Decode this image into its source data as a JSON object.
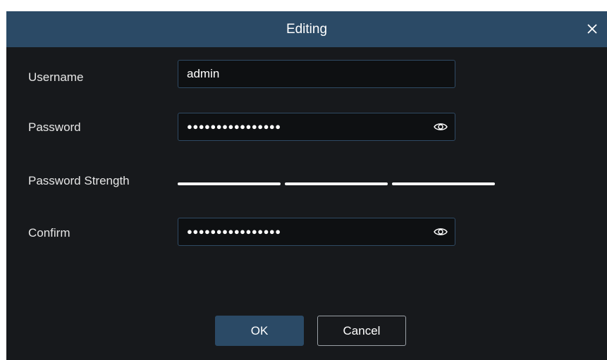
{
  "dialog": {
    "title": "Editing",
    "close_icon": "close-icon"
  },
  "form": {
    "username": {
      "label": "Username",
      "value": "admin"
    },
    "password": {
      "label": "Password",
      "value_masked": "●●●●●●●●●●●●●●●●",
      "reveal_icon": "eye-icon"
    },
    "strength": {
      "label": "Password Strength",
      "segments": 3,
      "filled": 3
    },
    "confirm": {
      "label": "Confirm",
      "value_masked": "●●●●●●●●●●●●●●●●",
      "reveal_icon": "eye-icon"
    }
  },
  "buttons": {
    "ok_label": "OK",
    "cancel_label": "Cancel"
  },
  "colors": {
    "titlebar": "#2b4a66",
    "background": "#17191c",
    "field_border": "#2f4a63",
    "text": "#ffffff"
  }
}
